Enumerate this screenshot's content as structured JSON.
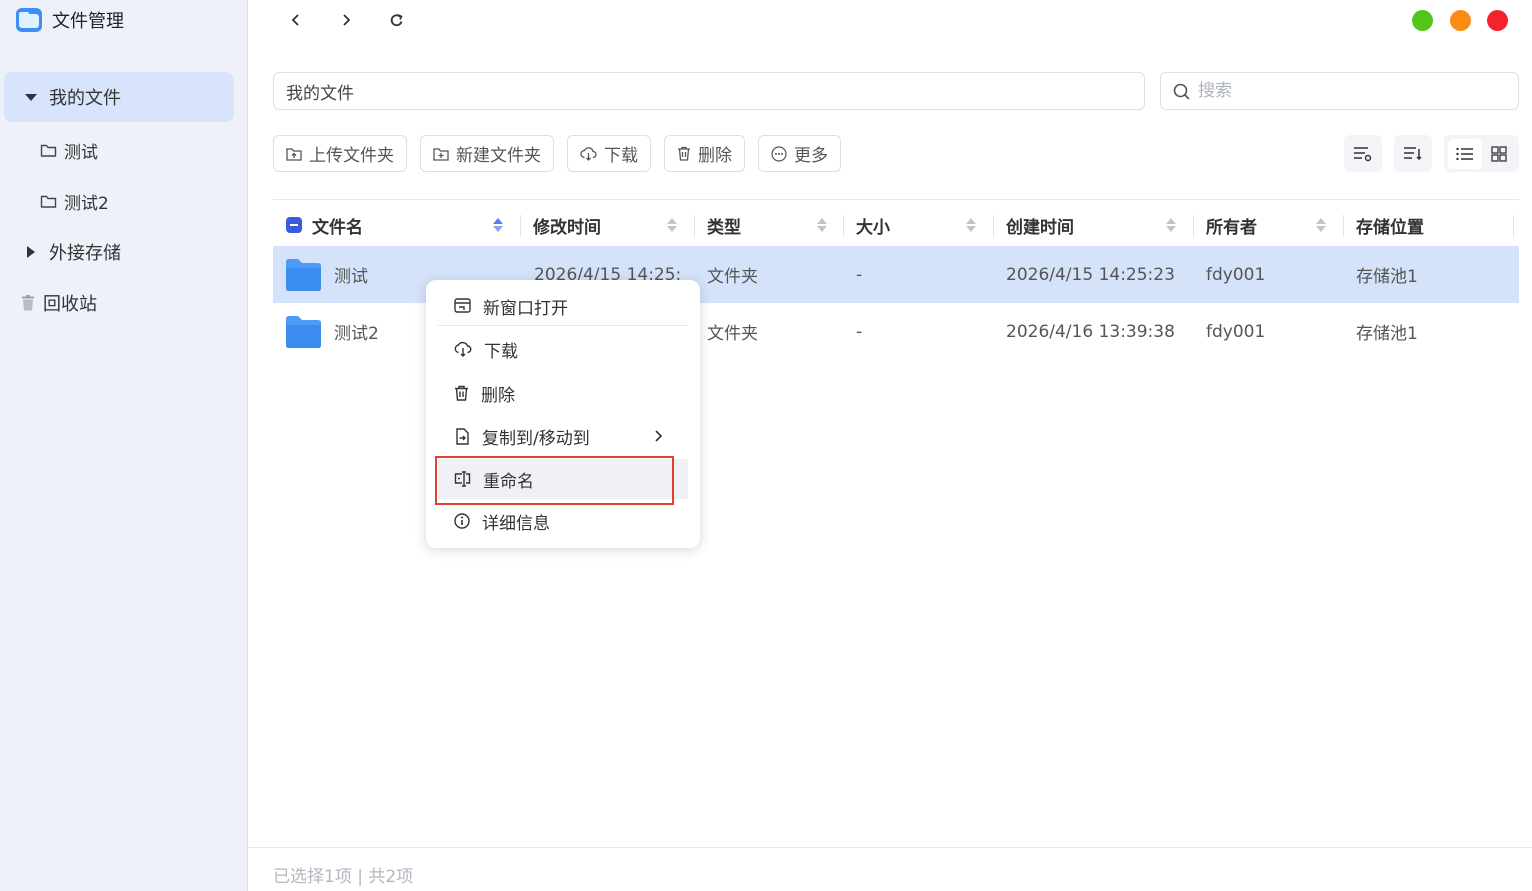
{
  "app": {
    "title": "文件管理"
  },
  "sidebar": {
    "items": [
      {
        "label": "我的文件",
        "icon": "caret-down-icon",
        "active": true
      },
      {
        "label": "测试",
        "icon": "folder-outline-icon"
      },
      {
        "label": "测试2",
        "icon": "folder-outline-icon"
      },
      {
        "label": "外接存储",
        "icon": "caret-right-icon"
      },
      {
        "label": "回收站",
        "icon": "trash-icon"
      }
    ]
  },
  "window_controls": {
    "colors": [
      "#52c41a",
      "#fa8c16",
      "#f5222d"
    ]
  },
  "path": {
    "value": "我的文件"
  },
  "search": {
    "placeholder": "搜索"
  },
  "toolbar": {
    "upload_folder": "上传文件夹",
    "new_folder": "新建文件夹",
    "download": "下载",
    "delete": "删除",
    "more": "更多"
  },
  "table": {
    "columns": [
      "文件名",
      "修改时间",
      "类型",
      "大小",
      "创建时间",
      "所有者",
      "存储位置"
    ],
    "rows": [
      {
        "name": "测试",
        "modified": "2026/4/15 14:25:",
        "type": "文件夹",
        "size": "-",
        "created": "2026/4/15 14:25:23",
        "owner": "fdy001",
        "location": "存储池1",
        "selected": true
      },
      {
        "name": "测试2",
        "modified": "",
        "type": "文件夹",
        "size": "-",
        "created": "2026/4/16 13:39:38",
        "owner": "fdy001",
        "location": "存储池1",
        "selected": false
      }
    ]
  },
  "context_menu": {
    "items": [
      {
        "label": "新窗口打开",
        "icon": "new-window-icon"
      },
      {
        "label": "下载",
        "icon": "cloud-download-icon"
      },
      {
        "label": "删除",
        "icon": "trash-icon"
      },
      {
        "label": "复制到/移动到",
        "icon": "move-to-icon"
      },
      {
        "label": "重命名",
        "icon": "rename-icon"
      },
      {
        "label": "详细信息",
        "icon": "info-icon"
      }
    ],
    "highlighted": "重命名"
  },
  "footer": {
    "status": "已选择1项 | 共2项"
  },
  "colors": {
    "accent": "#3b5bdb",
    "selected_row": "#d5e3fa",
    "sidebar_bg": "#eef1f9",
    "highlight_border": "#e2412e"
  }
}
